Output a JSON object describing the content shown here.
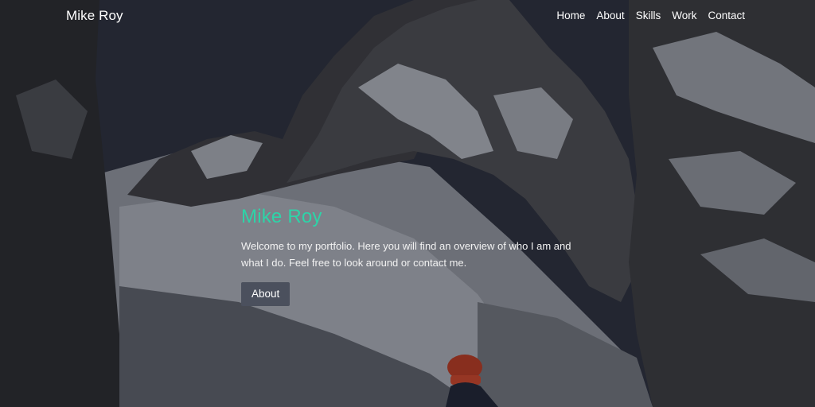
{
  "nav": {
    "brand": "Mike Roy",
    "links": [
      "Home",
      "About",
      "Skills",
      "Work",
      "Contact"
    ]
  },
  "hero": {
    "title": "Mike Roy",
    "text": "Welcome to my portfolio. Here you will find an overview of who I am and what I do. Feel free to look around or contact me.",
    "button_label": "About",
    "background": "snowy mountain landscape with hiker in red hat"
  },
  "colors": {
    "accent": "#2dd4a8",
    "button_bg": "#4b505d",
    "text": "#ffffff"
  }
}
